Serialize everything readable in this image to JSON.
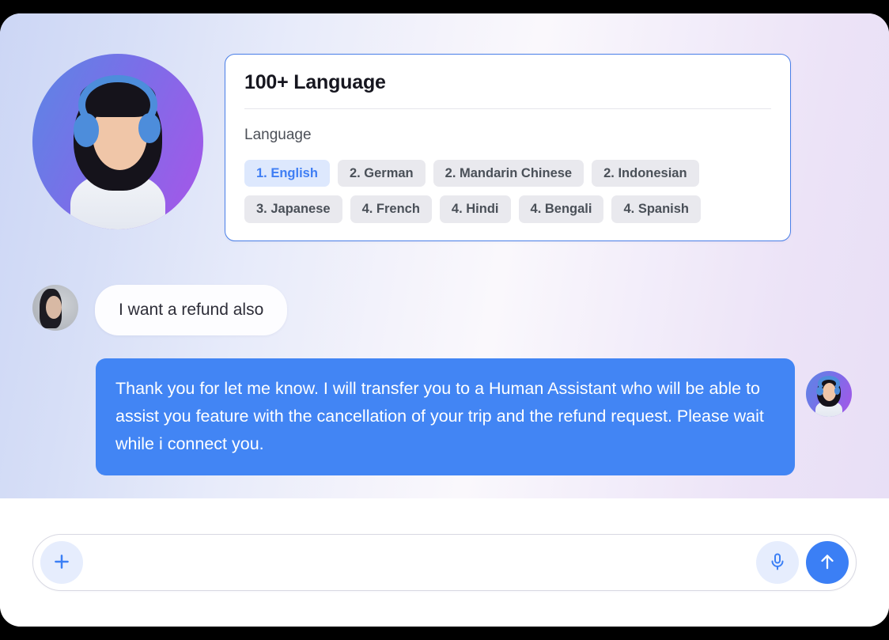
{
  "window": {
    "background_color": "#000000",
    "panel_radius_px": 26
  },
  "chat": {
    "background_gradient": [
      "#ccd6f5",
      "#faf8fc",
      "#e8dff6"
    ],
    "assistant_card": {
      "title": "100+ Language",
      "subtitle": "Language",
      "border_color": "#4a7fe8",
      "chip_rows": [
        [
          {
            "label": "1. English",
            "selected": true
          },
          {
            "label": "2. German",
            "selected": false
          },
          {
            "label": "2. Mandarin Chinese",
            "selected": false
          },
          {
            "label": "2. Indonesian",
            "selected": false
          }
        ],
        [
          {
            "label": "3. Japanese",
            "selected": false
          },
          {
            "label": "4. French",
            "selected": false
          },
          {
            "label": "4. Hindi",
            "selected": false
          },
          {
            "label": "4. Bengali",
            "selected": false
          },
          {
            "label": "4. Spanish",
            "selected": false
          }
        ]
      ],
      "chip_colors": {
        "default_bg": "#e9e9ee",
        "default_text": "#4a5058",
        "selected_bg": "#dde8fd",
        "selected_text": "#3f7ef4"
      }
    },
    "messages": [
      {
        "sender": "user",
        "text": "I want a refund also",
        "bubble_bg": "#fdfdff",
        "text_color": "#2d2d38"
      },
      {
        "sender": "assistant",
        "text": "Thank you for let me know. I will transfer you to a Human Assistant who will be able to assist you feature with the cancellation of your trip and the refund request. Please wait while i connect you.",
        "bubble_bg": "#4285f4",
        "text_color": "#ffffff"
      }
    ]
  },
  "composer": {
    "input_value": "",
    "placeholder": "",
    "attach_icon": "plus-icon",
    "mic_icon": "microphone-icon",
    "send_icon": "arrow-up-icon",
    "accent_color": "#3b7ff5",
    "light_button_bg": "#e6edfd"
  }
}
